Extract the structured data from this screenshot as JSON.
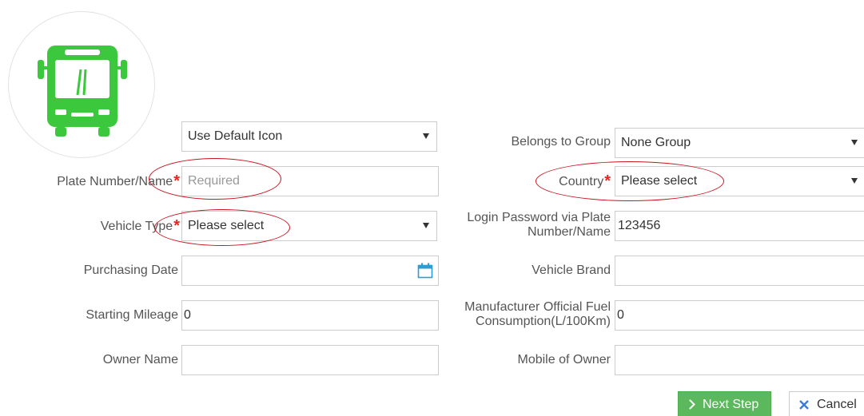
{
  "icon": {
    "select_value": "Use Default Icon",
    "vehicle_icon": "bus-icon"
  },
  "left": {
    "plate": {
      "label": "Plate Number/Name",
      "required": "*",
      "placeholder": "Required"
    },
    "vehicle_type": {
      "label": "Vehicle Type",
      "required": "*",
      "value": "Please select"
    },
    "purchasing_date": {
      "label": "Purchasing Date",
      "value": ""
    },
    "starting_mileage": {
      "label": "Starting Mileage",
      "value": "0"
    },
    "owner_name": {
      "label": "Owner Name",
      "value": ""
    }
  },
  "right": {
    "group": {
      "label": "Belongs to Group",
      "value": "None Group"
    },
    "country": {
      "label": "Country",
      "required": "*",
      "value": "Please select"
    },
    "login_password": {
      "label": "Login Password via Plate Number/Name",
      "value": "123456"
    },
    "vehicle_brand": {
      "label": "Vehicle Brand",
      "value": ""
    },
    "fuel": {
      "label": "Manufacturer Official Fuel Consumption(L/100Km)",
      "value": "0"
    },
    "mobile_owner": {
      "label": "Mobile of Owner",
      "value": ""
    }
  },
  "buttons": {
    "next": "Next Step",
    "cancel": "Cancel"
  },
  "colors": {
    "icon_green": "#3cc83c",
    "required_red": "#e0281e",
    "button_green": "#5cb85c",
    "highlight_red": "#c8141e",
    "cancel_blue": "#3a7bd5"
  }
}
